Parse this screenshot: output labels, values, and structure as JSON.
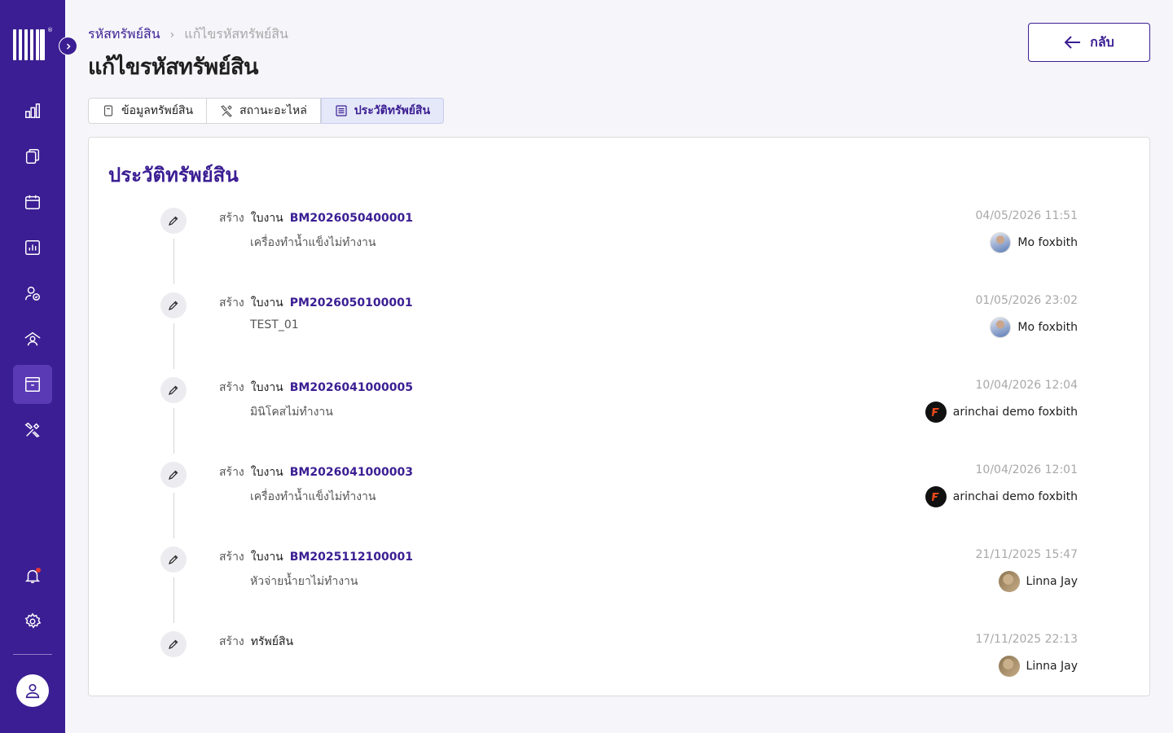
{
  "sidebar": {
    "nav_icons": [
      "dashboard-icon",
      "documents-icon",
      "calendar-icon",
      "report-icon",
      "user-check-icon",
      "home-person-icon",
      "asset-box-icon",
      "tools-icon"
    ],
    "active_item": "asset-box-icon",
    "bottom_icons": [
      "bell-icon",
      "gear-icon",
      "user-icon"
    ]
  },
  "breadcrumb": {
    "parent": "รหัสทรัพย์สิน",
    "current": "แก้ไขรหัสทรัพย์สิน"
  },
  "page_title": "แก้ไขรหัสทรัพย์สิน",
  "back_button": {
    "label": "กลับ"
  },
  "tabs": [
    {
      "label": "ข้อมูลทรัพย์สิน",
      "icon": "document-icon",
      "active": false
    },
    {
      "label": "สถานะอะไหล่",
      "icon": "tools-icon",
      "active": false
    },
    {
      "label": "ประวัติทรัพย์สิน",
      "icon": "list-icon",
      "active": true
    }
  ],
  "history": {
    "title": "ประวัติทรัพย์สิน",
    "items": [
      {
        "action": "สร้าง",
        "type": "ใบงาน",
        "code": "BM2026050400001",
        "description": "เครื่องทำน้ำแข็งไม่ทำงาน",
        "date": "04/05/2026 11:51",
        "user": "Mo foxbith"
      },
      {
        "action": "สร้าง",
        "type": "ใบงาน",
        "code": "PM2026050100001",
        "description": "TEST_01",
        "date": "01/05/2026 23:02",
        "user": "Mo foxbith"
      },
      {
        "action": "สร้าง",
        "type": "ใบงาน",
        "code": "BM2026041000005",
        "description": "มินิโคสไม่ทำงาน",
        "date": "10/04/2026 12:04",
        "user": "arinchai demo foxbith"
      },
      {
        "action": "สร้าง",
        "type": "ใบงาน",
        "code": "BM2026041000003",
        "description": "เครื่องทำน้ำแข็งไม่ทำงาน",
        "date": "10/04/2026 12:01",
        "user": "arinchai demo foxbith"
      },
      {
        "action": "สร้าง",
        "type": "ใบงาน",
        "code": "BM2025112100001",
        "description": "หัวจ่ายน้ำยาไม่ทำงาน",
        "date": "21/11/2025 15:47",
        "user": "Linna Jay"
      },
      {
        "action": "สร้าง",
        "type": "ทรัพย์สิน",
        "code": "",
        "description": "",
        "date": "17/11/2025 22:13",
        "user": "Linna Jay"
      }
    ]
  },
  "colors": {
    "sidebar": "#3b1e93",
    "accent": "#3b1e93",
    "active_tab_bg": "#e5e8f8"
  }
}
